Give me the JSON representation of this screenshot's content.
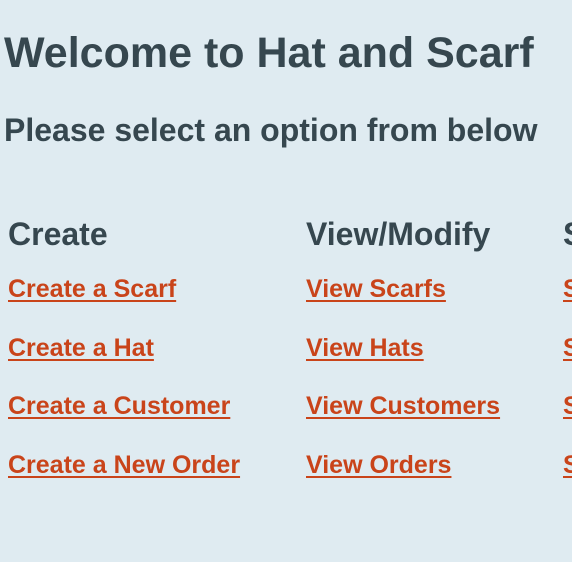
{
  "header": {
    "title": "Welcome to Hat and Scarf",
    "subtitle": "Please select an option from below"
  },
  "columns": [
    {
      "heading": "Create",
      "links": [
        "Create a Scarf",
        "Create a Hat",
        "Create a Customer",
        "Create a New Order"
      ]
    },
    {
      "heading": "View/Modify",
      "links": [
        "View Scarfs",
        "View Hats",
        "View Customers",
        "View Orders"
      ]
    },
    {
      "heading": "S",
      "links": [
        "S",
        "S",
        "S",
        "S"
      ]
    }
  ],
  "colors": {
    "background": "#dfebf1",
    "text": "#36474f",
    "link": "#c9441a"
  }
}
